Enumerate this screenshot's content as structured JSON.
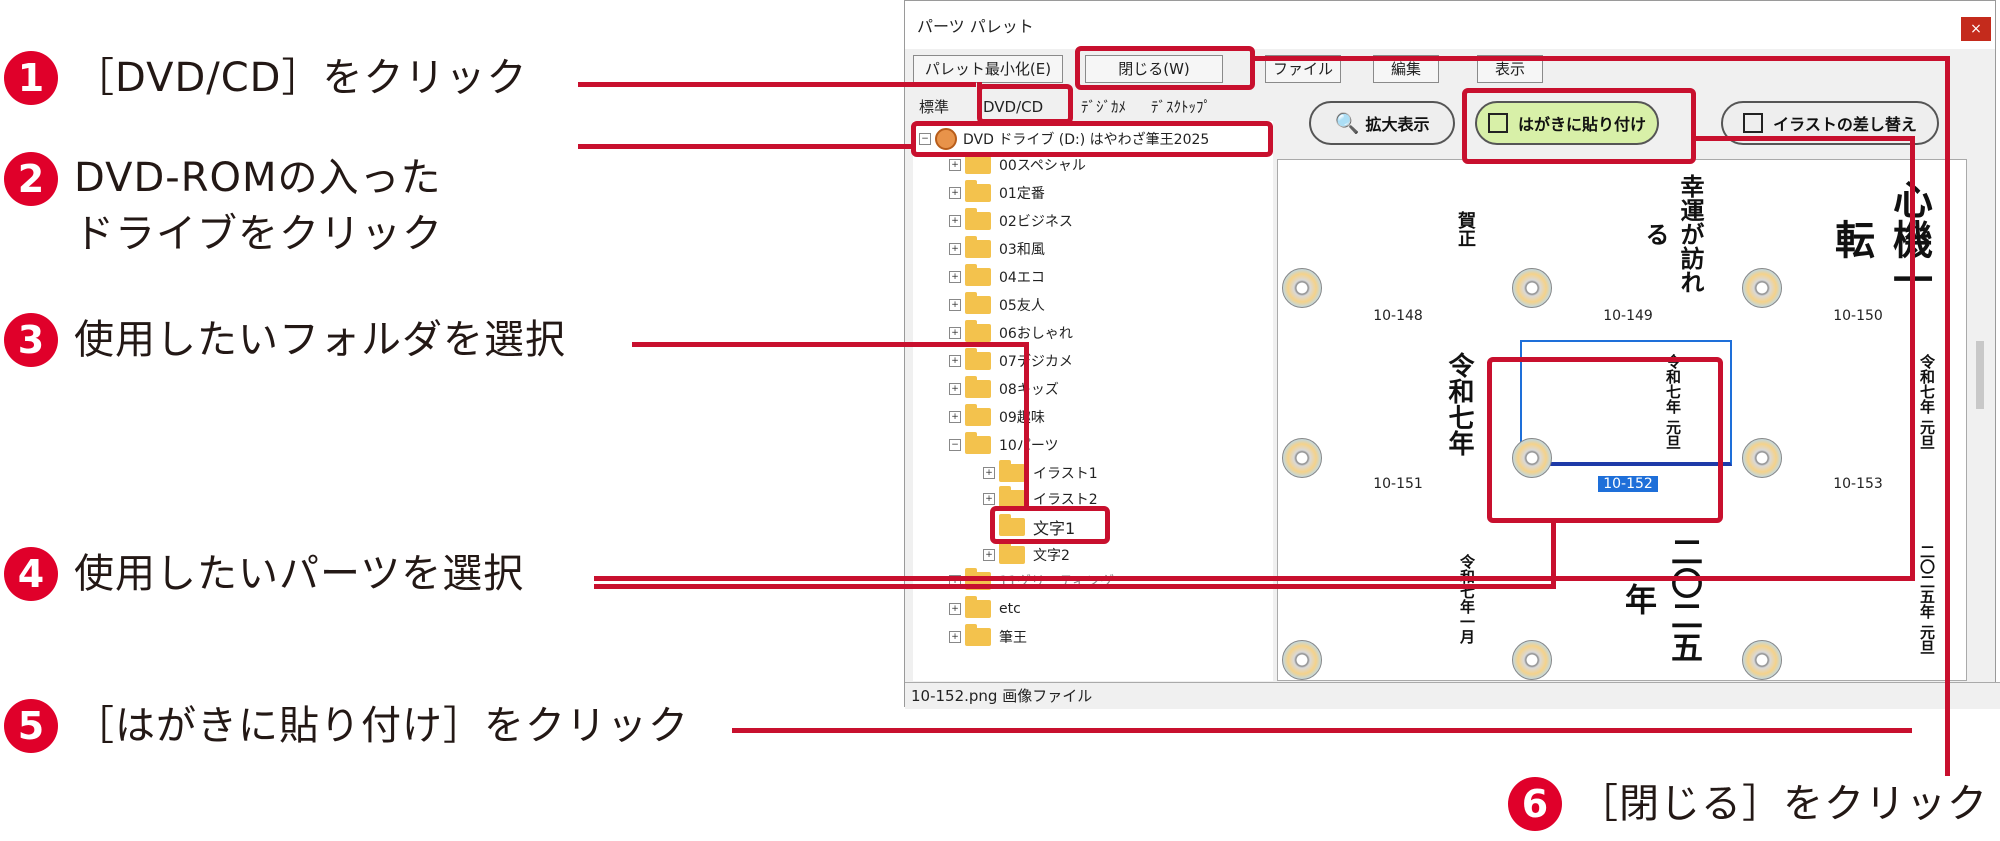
{
  "window": {
    "title": "パーツ パレット",
    "close_glyph": "×",
    "menu": {
      "minimize": "パレット最小化(E)",
      "close": "閉じる(W)",
      "file": "ファイル",
      "edit": "編集",
      "view": "表示"
    },
    "tabs": [
      "標準",
      "DVD/CD",
      "ﾃﾞｼﾞｶﾒ",
      "ﾃﾞｽｸﾄｯﾌﾟ"
    ],
    "tree": {
      "drive": "DVD ドライブ (D:) はやわざ筆王2025",
      "folders": [
        "00スペシャル",
        "01定番",
        "02ビジネス",
        "03和風",
        "04エコ",
        "05友人",
        "06おしゃれ",
        "07デジカメ",
        "08キッズ",
        "09趣味",
        "10パーツ"
      ],
      "subfolders": [
        "イラスト1",
        "イラスト2",
        "文字1",
        "文字2"
      ],
      "after": [
        "11グリーティング",
        "etc",
        "筆王"
      ]
    },
    "buttons": {
      "zoom": "拡大表示",
      "paste": "はがきに貼り付け",
      "replace": "イラストの差し替え"
    },
    "thumbs": [
      {
        "id": "10-148",
        "text": "賀正"
      },
      {
        "id": "10-149",
        "text": "幸運が訪れる"
      },
      {
        "id": "10-150",
        "text": "心機一転"
      },
      {
        "id": "10-151",
        "text": "令和七年"
      },
      {
        "id": "10-152",
        "text": "令和七年 元旦"
      },
      {
        "id": "10-153",
        "text": "令和七年 元旦"
      },
      {
        "id": "",
        "text": "令和七年一月"
      },
      {
        "id": "",
        "text": "二〇二五年"
      },
      {
        "id": "",
        "text": "二〇二五年 元旦"
      }
    ],
    "status": "10-152.png 画像ファイル"
  },
  "steps": [
    {
      "num": "1",
      "text": "［DVD/CD］をクリック"
    },
    {
      "num": "2",
      "text": "DVD-ROMの入った",
      "text2": "ドライブをクリック"
    },
    {
      "num": "3",
      "text": "使用したいフォルダを選択"
    },
    {
      "num": "4",
      "text": "使用したいパーツを選択"
    },
    {
      "num": "5",
      "text": "［はがきに貼り付け］をクリック"
    },
    {
      "num": "6",
      "text": "［閉じる］をクリック"
    }
  ],
  "colors": {
    "accent": "#c8102e",
    "badge": "#e0002a",
    "selection": "#1e6fd9"
  }
}
